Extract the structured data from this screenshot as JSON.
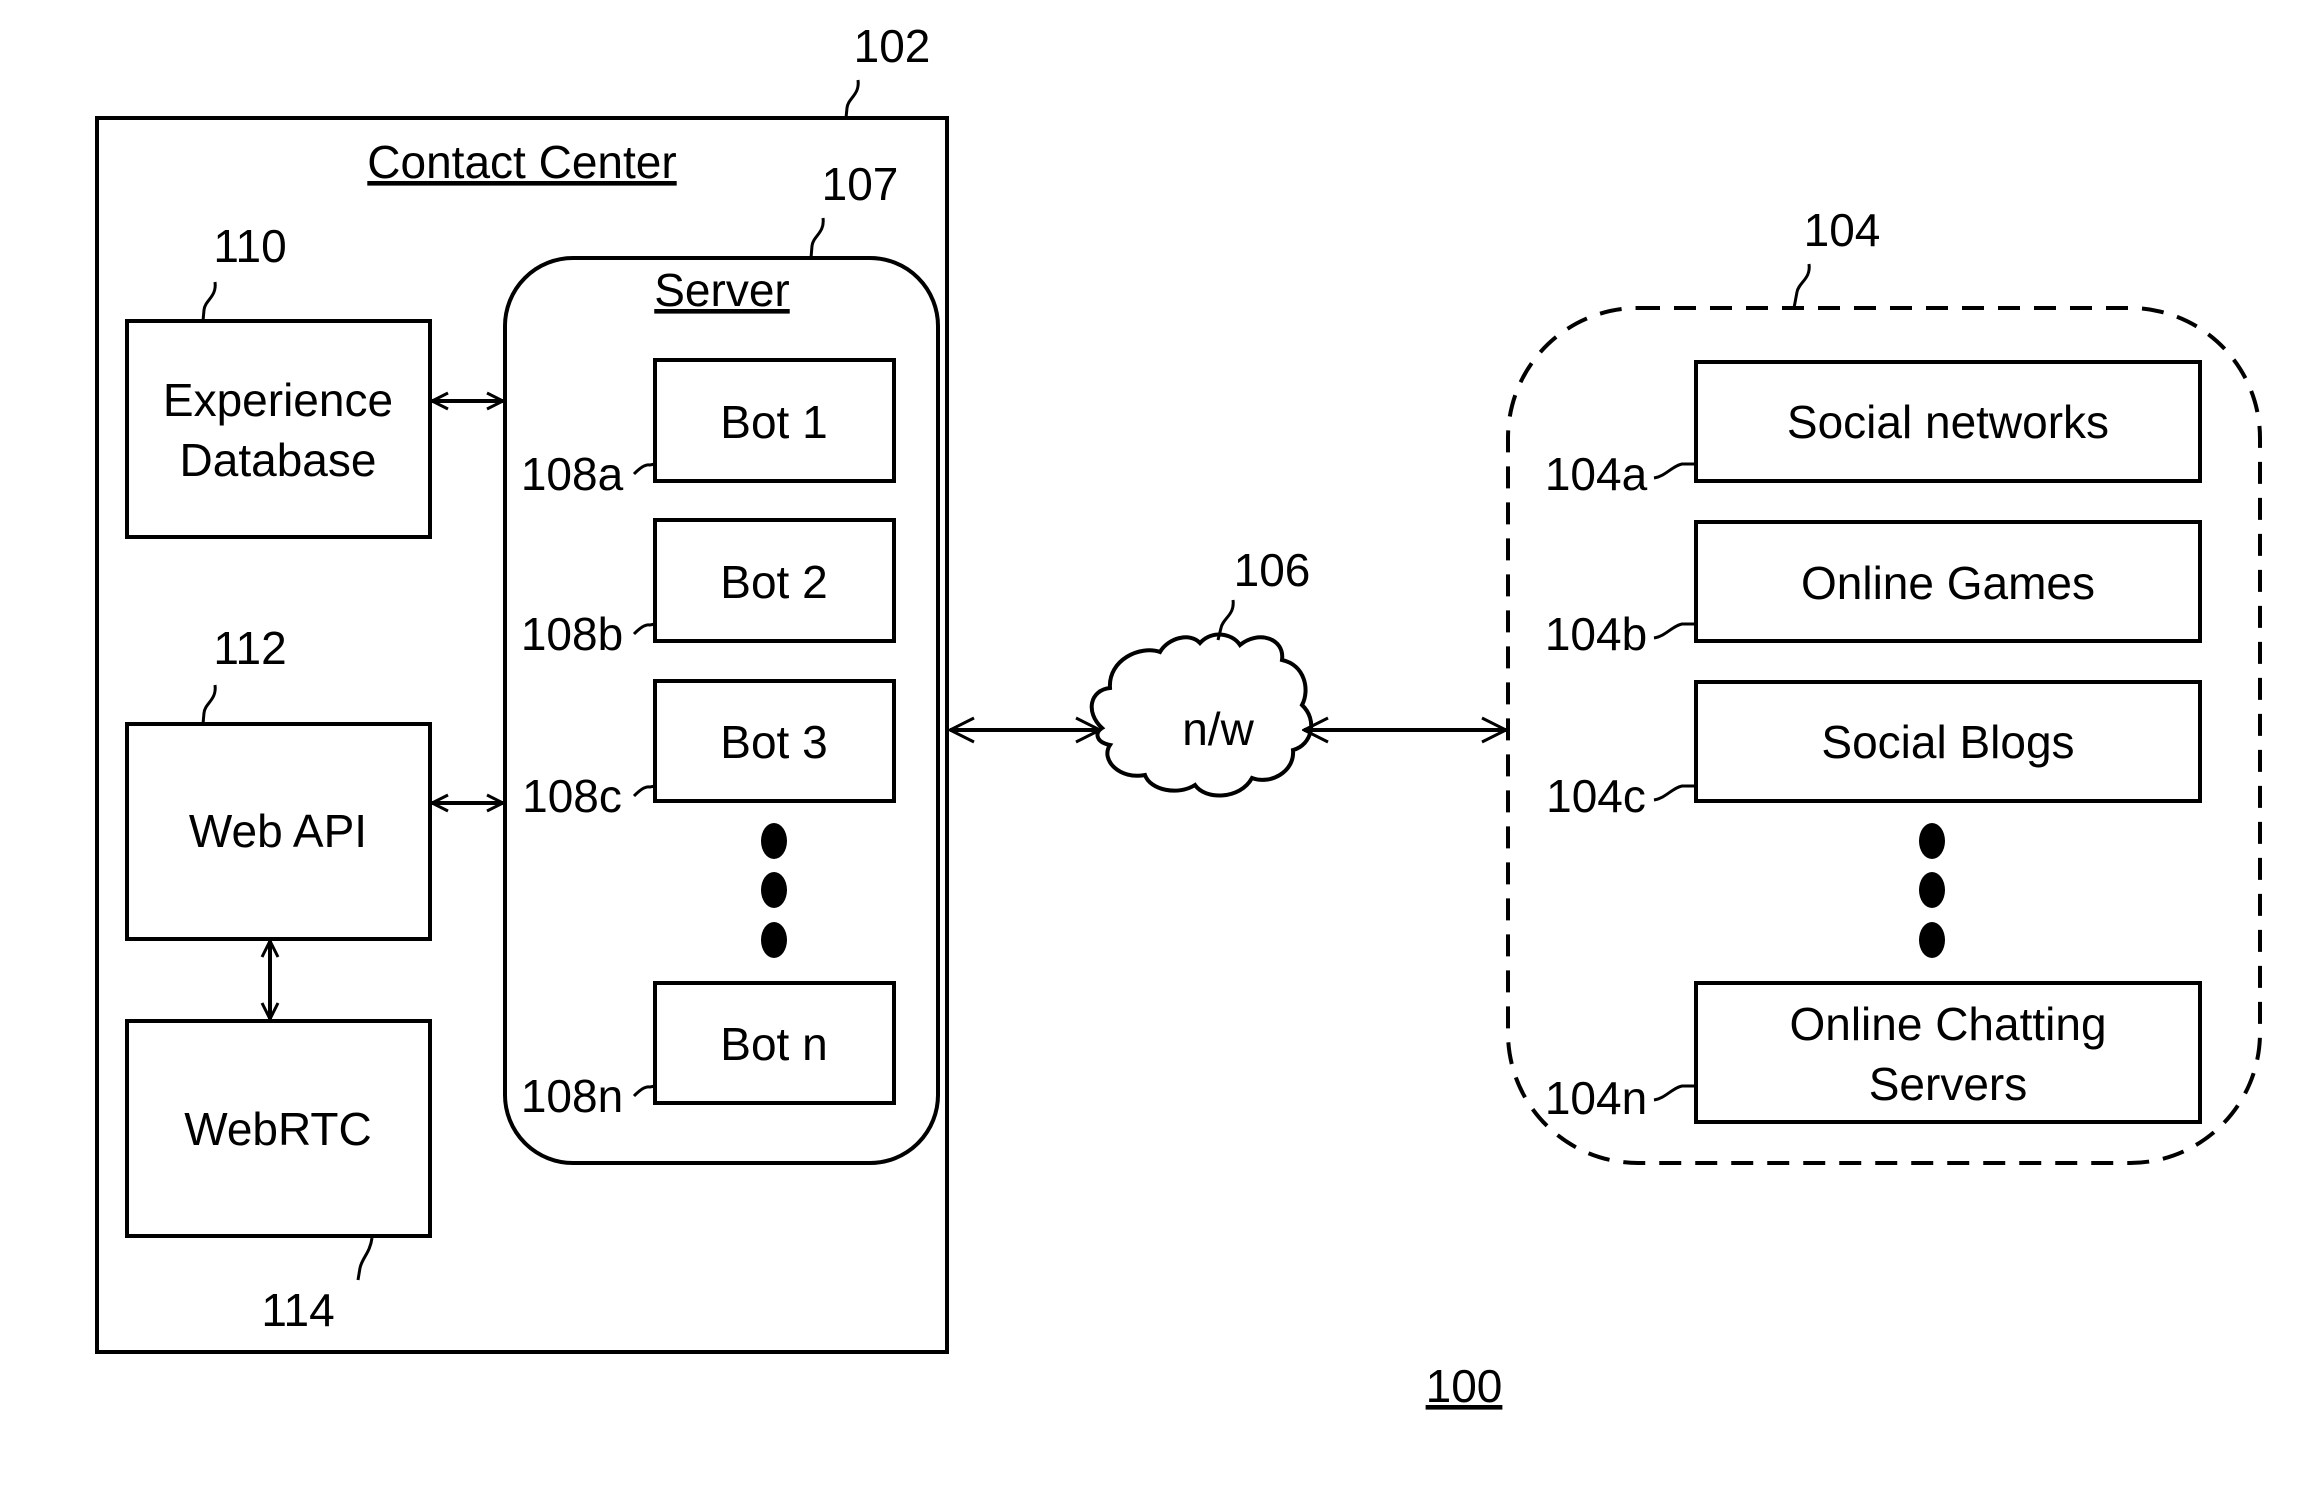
{
  "figure": {
    "ref": "100",
    "contact_center": {
      "ref": "102",
      "title": "Contact Center",
      "experience_database": {
        "ref": "110",
        "lines": [
          "Experience",
          "Database"
        ]
      },
      "web_api": {
        "ref": "112",
        "label": "Web API"
      },
      "webrtc": {
        "ref": "114",
        "label": "WebRTC"
      },
      "server": {
        "ref": "107",
        "title": "Server",
        "bots": [
          {
            "ref": "108a",
            "label": "Bot 1"
          },
          {
            "ref": "108b",
            "label": "Bot 2"
          },
          {
            "ref": "108c",
            "label": "Bot 3"
          },
          {
            "ref": "108n",
            "label": "Bot n"
          }
        ]
      }
    },
    "network": {
      "ref": "106",
      "label": "n/w"
    },
    "sources": {
      "ref": "104",
      "items": [
        {
          "ref": "104a",
          "lines": [
            "Social networks"
          ]
        },
        {
          "ref": "104b",
          "lines": [
            "Online Games"
          ]
        },
        {
          "ref": "104c",
          "lines": [
            "Social Blogs"
          ]
        },
        {
          "ref": "104n",
          "lines": [
            "Online Chatting",
            "Servers"
          ]
        }
      ]
    }
  }
}
